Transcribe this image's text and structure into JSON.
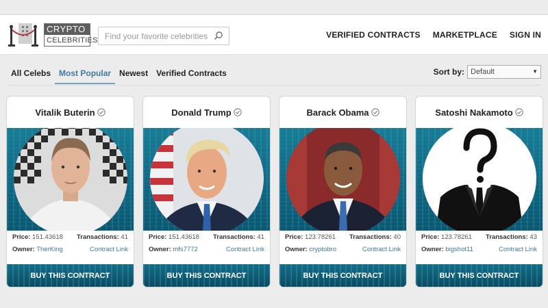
{
  "header": {
    "logo_top": "CRYPTO",
    "logo_bottom": "CELEBRITIES",
    "search_placeholder": "Find your favorite celebrities",
    "nav": [
      "VERIFIED CONTRACTS",
      "MARKETPLACE",
      "SIGN IN"
    ]
  },
  "tabs": [
    {
      "label": "All Celebs",
      "active": false
    },
    {
      "label": "Most Popular",
      "active": true
    },
    {
      "label": "Newest",
      "active": false
    },
    {
      "label": "Verified Contracts",
      "active": false
    }
  ],
  "sort": {
    "label": "Sort by:",
    "value": "Default"
  },
  "cards": [
    {
      "name": "Vitalik Buterin",
      "price_label": "Price:",
      "price": "151.43618",
      "tx_label": "Transactions:",
      "tx": "41",
      "owner_label": "Owner:",
      "owner": "TherKing",
      "contract_link": "Contract Link",
      "buy": "BUY THIS CONTRACT"
    },
    {
      "name": "Donald Trump",
      "price_label": "Price:",
      "price": "151.43618",
      "tx_label": "Transactions:",
      "tx": "41",
      "owner_label": "Owner:",
      "owner": "mfs7772",
      "contract_link": "Contract Link",
      "buy": "BUY THIS CONTRACT"
    },
    {
      "name": "Barack Obama",
      "price_label": "Price:",
      "price": "123.78261",
      "tx_label": "Transactions:",
      "tx": "40",
      "owner_label": "Owner:",
      "owner": "cryptobro",
      "contract_link": "Contract Link",
      "buy": "BUY THIS CONTRACT"
    },
    {
      "name": "Satoshi Nakamoto",
      "price_label": "Price:",
      "price": "123.78261",
      "tx_label": "Transactions:",
      "tx": "43",
      "owner_label": "Owner:",
      "owner": "bigshot11",
      "contract_link": "Contract Link",
      "buy": "BUY THIS CONTRACT"
    }
  ],
  "colors": {
    "accent": "#3c7a9f",
    "card_bg": "#0e5f78"
  }
}
